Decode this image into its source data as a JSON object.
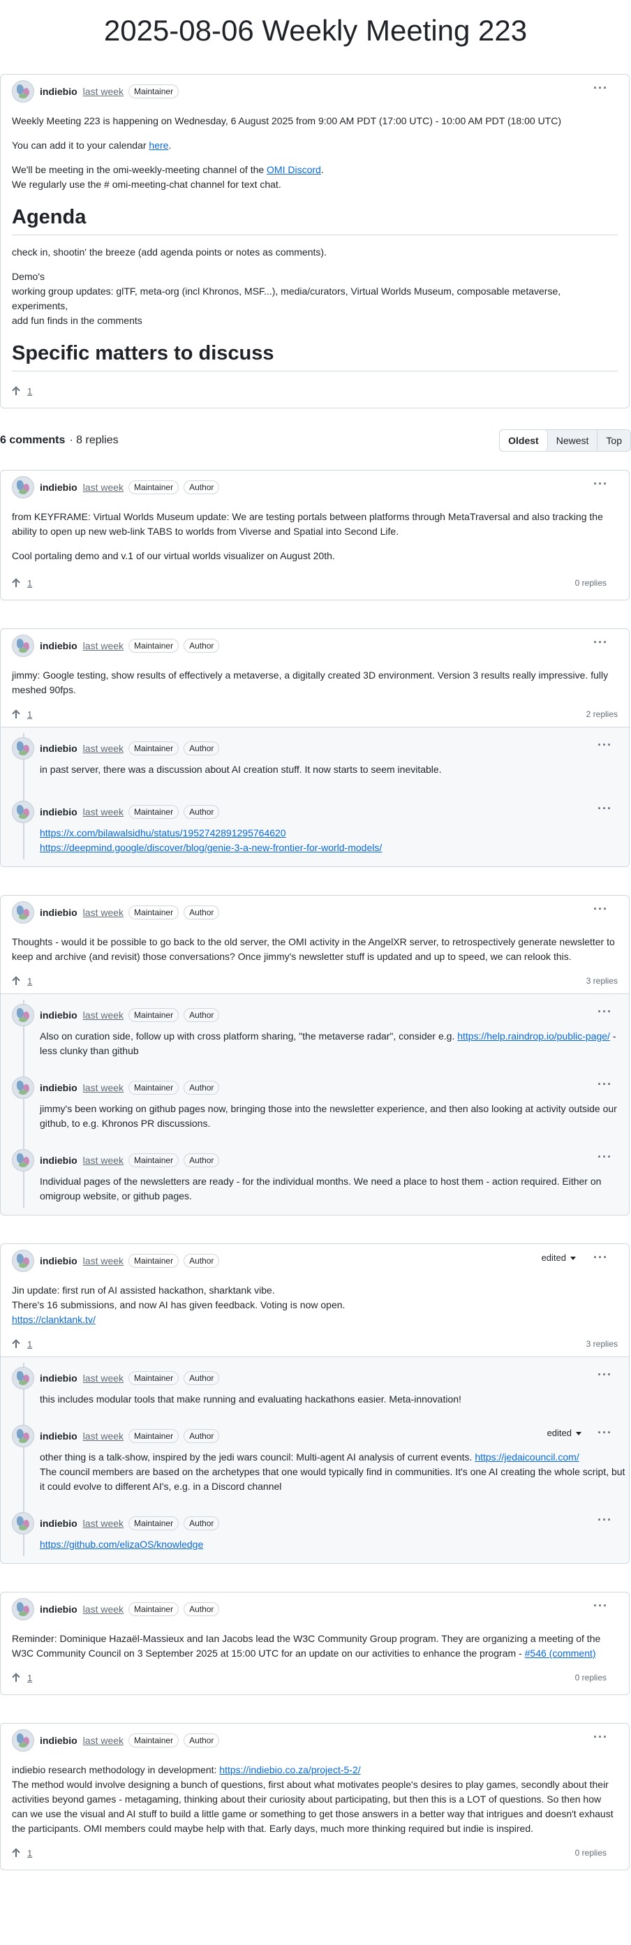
{
  "page": {
    "title": "2025-08-06 Weekly Meeting 223"
  },
  "badges": {
    "maintainer": "Maintainer",
    "author": "Author"
  },
  "post": {
    "author": "indiebio",
    "time": "last week",
    "upvotes": "1",
    "p1": "Weekly Meeting 223 is happening on Wednesday, 6 August 2025 from 9:00 AM PDT (17:00 UTC) - 10:00 AM PDT (18:00 UTC)",
    "p2_pre": "You can add it to your calendar ",
    "p2_link": "here",
    "p2_post": ".",
    "p3_pre": "We'll be meeting in the omi-weekly-meeting channel of the ",
    "p3_link": "OMI Discord",
    "p3_post": ".",
    "p4": "We regularly use the # omi-meeting-chat channel for text chat.",
    "agenda_heading": "Agenda",
    "agenda_p1": "check in, shootin' the breeze (add agenda points or notes as comments).",
    "agenda_l1": "Demo's",
    "agenda_l2": "working group updates: glTF, meta-org (incl Khronos, MSF...), media/curators, Virtual Worlds Museum, composable metaverse, experiments,",
    "agenda_l3": "add fun finds in the comments",
    "matters_heading": "Specific matters to discuss"
  },
  "toolbar": {
    "count": "6 comments",
    "replies": "· 8 replies",
    "sort_oldest": "Oldest",
    "sort_newest": "Newest",
    "sort_top": "Top"
  },
  "comments": [
    {
      "author": "indiebio",
      "time": "last week",
      "upvotes": "1",
      "replies_label": "0 replies",
      "p1": "from KEYFRAME: Virtual Worlds Museum update: We are testing portals between platforms through MetaTraversal and also tracking the ability to open up new web-link TABS to worlds from Viverse and Spatial into Second Life.",
      "p2": "Cool portaling demo and v.1 of our virtual worlds visualizer on August 20th."
    },
    {
      "author": "indiebio",
      "time": "last week",
      "upvotes": "1",
      "replies_label": "2 replies",
      "p1": "jimmy: Google testing, show results of effectively a metaverse, a digitally created 3D environment. Version 3 results really impressive. fully meshed 90fps.",
      "replies": [
        {
          "author": "indiebio",
          "time": "last week",
          "text": "in past server, there was a discussion about AI creation stuff. It now starts to seem inevitable."
        },
        {
          "author": "indiebio",
          "time": "last week",
          "link1": "https://x.com/bilawalsidhu/status/1952742891295764620",
          "link2": "https://deepmind.google/discover/blog/genie-3-a-new-frontier-for-world-models/"
        }
      ]
    },
    {
      "author": "indiebio",
      "time": "last week",
      "upvotes": "1",
      "replies_label": "3 replies",
      "p1": "Thoughts - would it be possible to go back to the old server, the OMI activity in the AngelXR server, to retrospectively generate newsletter to keep and archive (and revisit) those conversations? Once jimmy's newsletter stuff is updated and up to speed, we can relook this.",
      "replies": [
        {
          "author": "indiebio",
          "time": "last week",
          "pre": "Also on curation side, follow up with cross platform sharing, \"the metaverse radar\", consider e.g. ",
          "link": "https://help.raindrop.io/public-page/",
          "post": " - less clunky than github"
        },
        {
          "author": "indiebio",
          "time": "last week",
          "text": "jimmy's been working on github pages now, bringing those into the newsletter experience, and then also looking at activity outside our github, to e.g. Khronos PR discussions."
        },
        {
          "author": "indiebio",
          "time": "last week",
          "text": "Individual pages of the newsletters are ready - for the individual months. We need a place to host them - action required. Either on omigroup website, or github pages."
        }
      ]
    },
    {
      "author": "indiebio",
      "time": "last week",
      "upvotes": "1",
      "replies_label": "3 replies",
      "edited": "edited",
      "l1": "Jin update: first run of AI assisted hackathon, sharktank vibe.",
      "l2": "There's 16 submissions, and now AI has given feedback. Voting is now open.",
      "link": "https://clanktank.tv/",
      "replies": [
        {
          "author": "indiebio",
          "time": "last week",
          "text": "this includes modular tools that make running and evaluating hackathons easier. Meta-innovation!"
        },
        {
          "author": "indiebio",
          "time": "last week",
          "edited": "edited",
          "pre": "other thing is a talk-show, inspired by the jedi wars council: Multi-agent AI analysis of current events. ",
          "link": "https://jedaicouncil.com/",
          "post": "The council members are based on the archetypes that one would typically find in communities. It's one AI creating the whole script, but it could evolve to different AI's, e.g. in a Discord channel"
        },
        {
          "author": "indiebio",
          "time": "last week",
          "link": "https://github.com/elizaOS/knowledge"
        }
      ]
    },
    {
      "author": "indiebio",
      "time": "last week",
      "upvotes": "1",
      "replies_label": "0 replies",
      "pre": "Reminder: Dominique Hazaël-Massieux and Ian Jacobs lead the W3C Community Group program. They are organizing a meeting of the W3C Community Council on 3 September 2025 at 15:00 UTC for an update on our activities to enhance the program - ",
      "link": "#546 (comment)"
    },
    {
      "author": "indiebio",
      "time": "last week",
      "upvotes": "1",
      "replies_label": "0 replies",
      "pre": "indiebio research methodology in development: ",
      "link": "https://indiebio.co.za/project-5-2/",
      "p2": "The method would involve designing a bunch of questions, first about what motivates people's desires to play games, secondly about their activities beyond games - metagaming, thinking about their curiosity about participating, but then this is a LOT of questions. So then how can we use the visual and AI stuff to build a little game or something to get those answers in a better way that intrigues and doesn't exhaust the participants. OMI members could maybe help with that. Early days, much more thinking required but indie is inspired."
    }
  ],
  "icons": {
    "avatar": "avatar-icon",
    "more": "kebab-icon",
    "upvote": "arrow-up-icon",
    "caret": "chevron-down-icon"
  }
}
